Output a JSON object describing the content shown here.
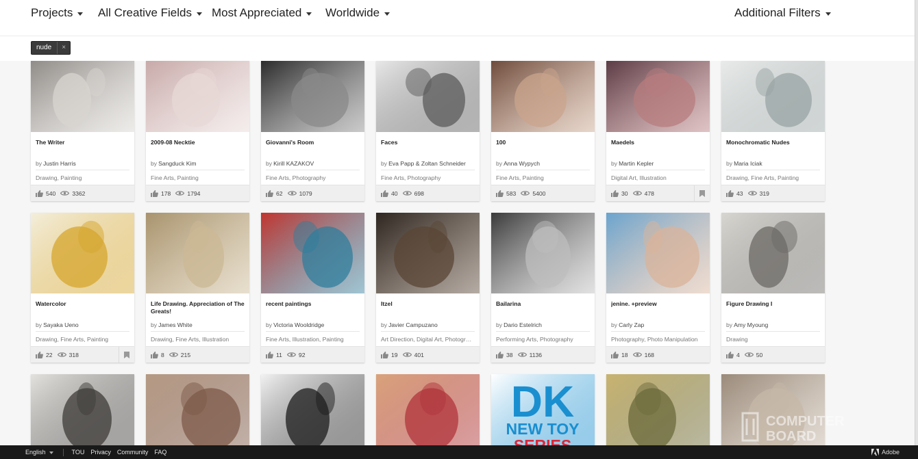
{
  "filters": {
    "type": "Projects",
    "field": "All Creative Fields",
    "sort": "Most Appreciated",
    "location": "Worldwide",
    "additional": "Additional Filters"
  },
  "tag": {
    "label": "nude",
    "close": "×"
  },
  "by_label": "by",
  "projects": [
    {
      "title": "The Writer",
      "owner": "Justin Harris",
      "fields": "Drawing, Painting",
      "appreciations": "540",
      "views": "3362",
      "thumb": "#8f8b87",
      "thumb2": "#d8d4cf",
      "bookmark": false
    },
    {
      "title": "2009-08 Necktie",
      "owner": "Sangduck Kim",
      "fields": "Fine Arts, Painting",
      "appreciations": "178",
      "views": "1794",
      "thumb": "#c7a9a8",
      "thumb2": "#e7d8d6",
      "bookmark": false
    },
    {
      "title": "Giovanni's Room",
      "owner": "Kirill KAZAKOV",
      "fields": "Fine Arts, Photography",
      "appreciations": "62",
      "views": "1079",
      "thumb": "#2b2b2b",
      "thumb2": "#8a8a8a",
      "bookmark": false
    },
    {
      "title": "Faces",
      "owner": "Eva Papp & Zoltan Schneider",
      "fields": "Fine Arts, Photography",
      "appreciations": "40",
      "views": "698",
      "thumb": "#e8e8e8",
      "thumb2": "#5b5b5b",
      "bookmark": false
    },
    {
      "title": "100",
      "owner": "Anna Wypych",
      "fields": "Fine Arts, Painting",
      "appreciations": "583",
      "views": "5400",
      "thumb": "#6e4b3c",
      "thumb2": "#c9a48c",
      "bookmark": false
    },
    {
      "title": "Maedels",
      "owner": "Martin Kepler",
      "fields": "Digital Art, Illustration",
      "appreciations": "30",
      "views": "478",
      "thumb": "#5b3b45",
      "thumb2": "#b77c7e",
      "bookmark": true
    },
    {
      "title": "Monochromatic Nudes",
      "owner": "Maria Iciak",
      "fields": "Drawing, Fine Arts, Painting",
      "appreciations": "43",
      "views": "319",
      "thumb": "#e9ebea",
      "thumb2": "#9aa4a4",
      "bookmark": false
    },
    {
      "title": "Watercolor",
      "owner": "Sayaka Ueno",
      "fields": "Drawing, Fine Arts, Painting",
      "appreciations": "22",
      "views": "318",
      "thumb": "#f3eedc",
      "thumb2": "#d6a62e",
      "bookmark": true
    },
    {
      "title": "Life Drawing. Appreciation of The Greats!",
      "owner": "James White",
      "fields": "Drawing, Fine Arts, Illustration",
      "appreciations": "8",
      "views": "215",
      "thumb": "#a8936d",
      "thumb2": "#cbb894",
      "bookmark": false
    },
    {
      "title": "recent paintings",
      "owner": "Victoria Wooldridge",
      "fields": "Fine Arts, Illustration, Painting",
      "appreciations": "11",
      "views": "92",
      "thumb": "#c2342e",
      "thumb2": "#2f7e9c",
      "bookmark": false
    },
    {
      "title": "Itzel",
      "owner": "Javier Campuzano",
      "fields": "Art Direction, Digital Art, Photography",
      "appreciations": "19",
      "views": "401",
      "thumb": "#2e2620",
      "thumb2": "#5a4636",
      "bookmark": false
    },
    {
      "title": "Bailarina",
      "owner": "Dario Estelrich",
      "fields": "Performing Arts, Photography",
      "appreciations": "38",
      "views": "1136",
      "thumb": "#3a3a3a",
      "thumb2": "#bdbdbd",
      "bookmark": false
    },
    {
      "title": "jenine. +preview",
      "owner": "Carly Zap",
      "fields": "Photography, Photo Manipulation",
      "appreciations": "18",
      "views": "168",
      "thumb": "#6aa4cf",
      "thumb2": "#d9b39a",
      "bookmark": false
    },
    {
      "title": "Figure Drawing I",
      "owner": "Amy Myoung",
      "fields": "Drawing",
      "appreciations": "4",
      "views": "50",
      "thumb": "#d8d6d0",
      "thumb2": "#6c6a66",
      "bookmark": false
    },
    {
      "title": "",
      "owner": "",
      "fields": "",
      "appreciations": "",
      "views": "",
      "thumb": "#e4e2de",
      "thumb2": "#3d3b38",
      "bookmark": false
    },
    {
      "title": "",
      "owner": "",
      "fields": "",
      "appreciations": "",
      "views": "",
      "thumb": "#b59a84",
      "thumb2": "#7e5a4a",
      "bookmark": false
    },
    {
      "title": "",
      "owner": "",
      "fields": "",
      "appreciations": "",
      "views": "",
      "thumb": "#f2f2f2",
      "thumb2": "#1c1c1c",
      "bookmark": false
    },
    {
      "title": "",
      "owner": "",
      "fields": "",
      "appreciations": "",
      "views": "",
      "thumb": "#d9a37b",
      "thumb2": "#b0343b",
      "bookmark": false
    },
    {
      "title": "",
      "owner": "",
      "fields": "",
      "appreciations": "",
      "views": "",
      "thumb": "#ffffff",
      "thumb2": "#1a8fd0",
      "bookmark": false,
      "dk_text": "DK",
      "dk_sub": "NEW TOY",
      "dk_sub2": "SERIES"
    },
    {
      "title": "",
      "owner": "",
      "fields": "",
      "appreciations": "",
      "views": "",
      "thumb": "#c9b470",
      "thumb2": "#6b6a3b",
      "bookmark": false
    },
    {
      "title": "",
      "owner": "",
      "fields": "",
      "appreciations": "",
      "views": "",
      "thumb": "#9a8a7a",
      "thumb2": "#c6b8a8",
      "bookmark": false
    }
  ],
  "footer": {
    "language": "English",
    "links": [
      "TOU",
      "Privacy",
      "Community",
      "FAQ"
    ],
    "brand": "Adobe"
  },
  "watermark": {
    "line1": "COMPUTER",
    "line2": "BOARD"
  },
  "colors": {
    "footer_bg": "#191919",
    "tag_bg": "#3b3b3b",
    "page_bg": "#f6f6f6"
  }
}
